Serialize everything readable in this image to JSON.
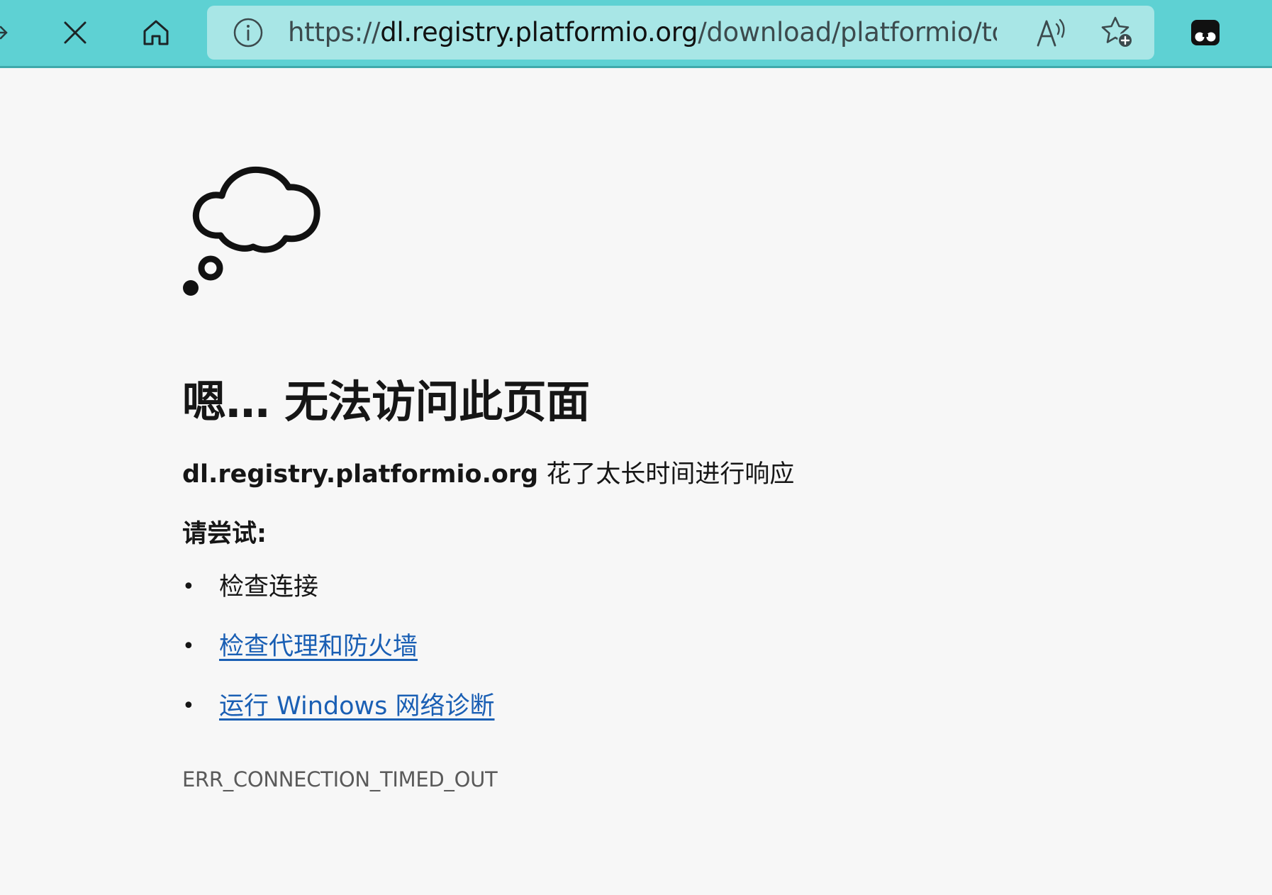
{
  "browser": {
    "url_scheme": "https://",
    "url_host": "dl.registry.platformio.org",
    "url_path": "/download/platformio/tool/t...",
    "icons": {
      "back": "back-arrow-icon",
      "stop": "close-icon",
      "home": "home-icon",
      "info": "info-icon",
      "read_aloud": "read-aloud-icon",
      "favorite": "add-favorite-icon",
      "extension": "glasses-extension-icon"
    },
    "accent_color": "#5ed1d3"
  },
  "error_page": {
    "title": "嗯… 无法访问此页面",
    "host": "dl.registry.platformio.org",
    "message": " 花了太长时间进行响应",
    "try_heading": "请尝试:",
    "suggestions": [
      {
        "text": "检查连接",
        "link": false
      },
      {
        "text": "检查代理和防火墙",
        "link": true
      },
      {
        "text": "运行 Windows 网络诊断",
        "link": true
      }
    ],
    "error_code": "ERR_CONNECTION_TIMED_OUT",
    "link_color": "#1a5fb4"
  }
}
